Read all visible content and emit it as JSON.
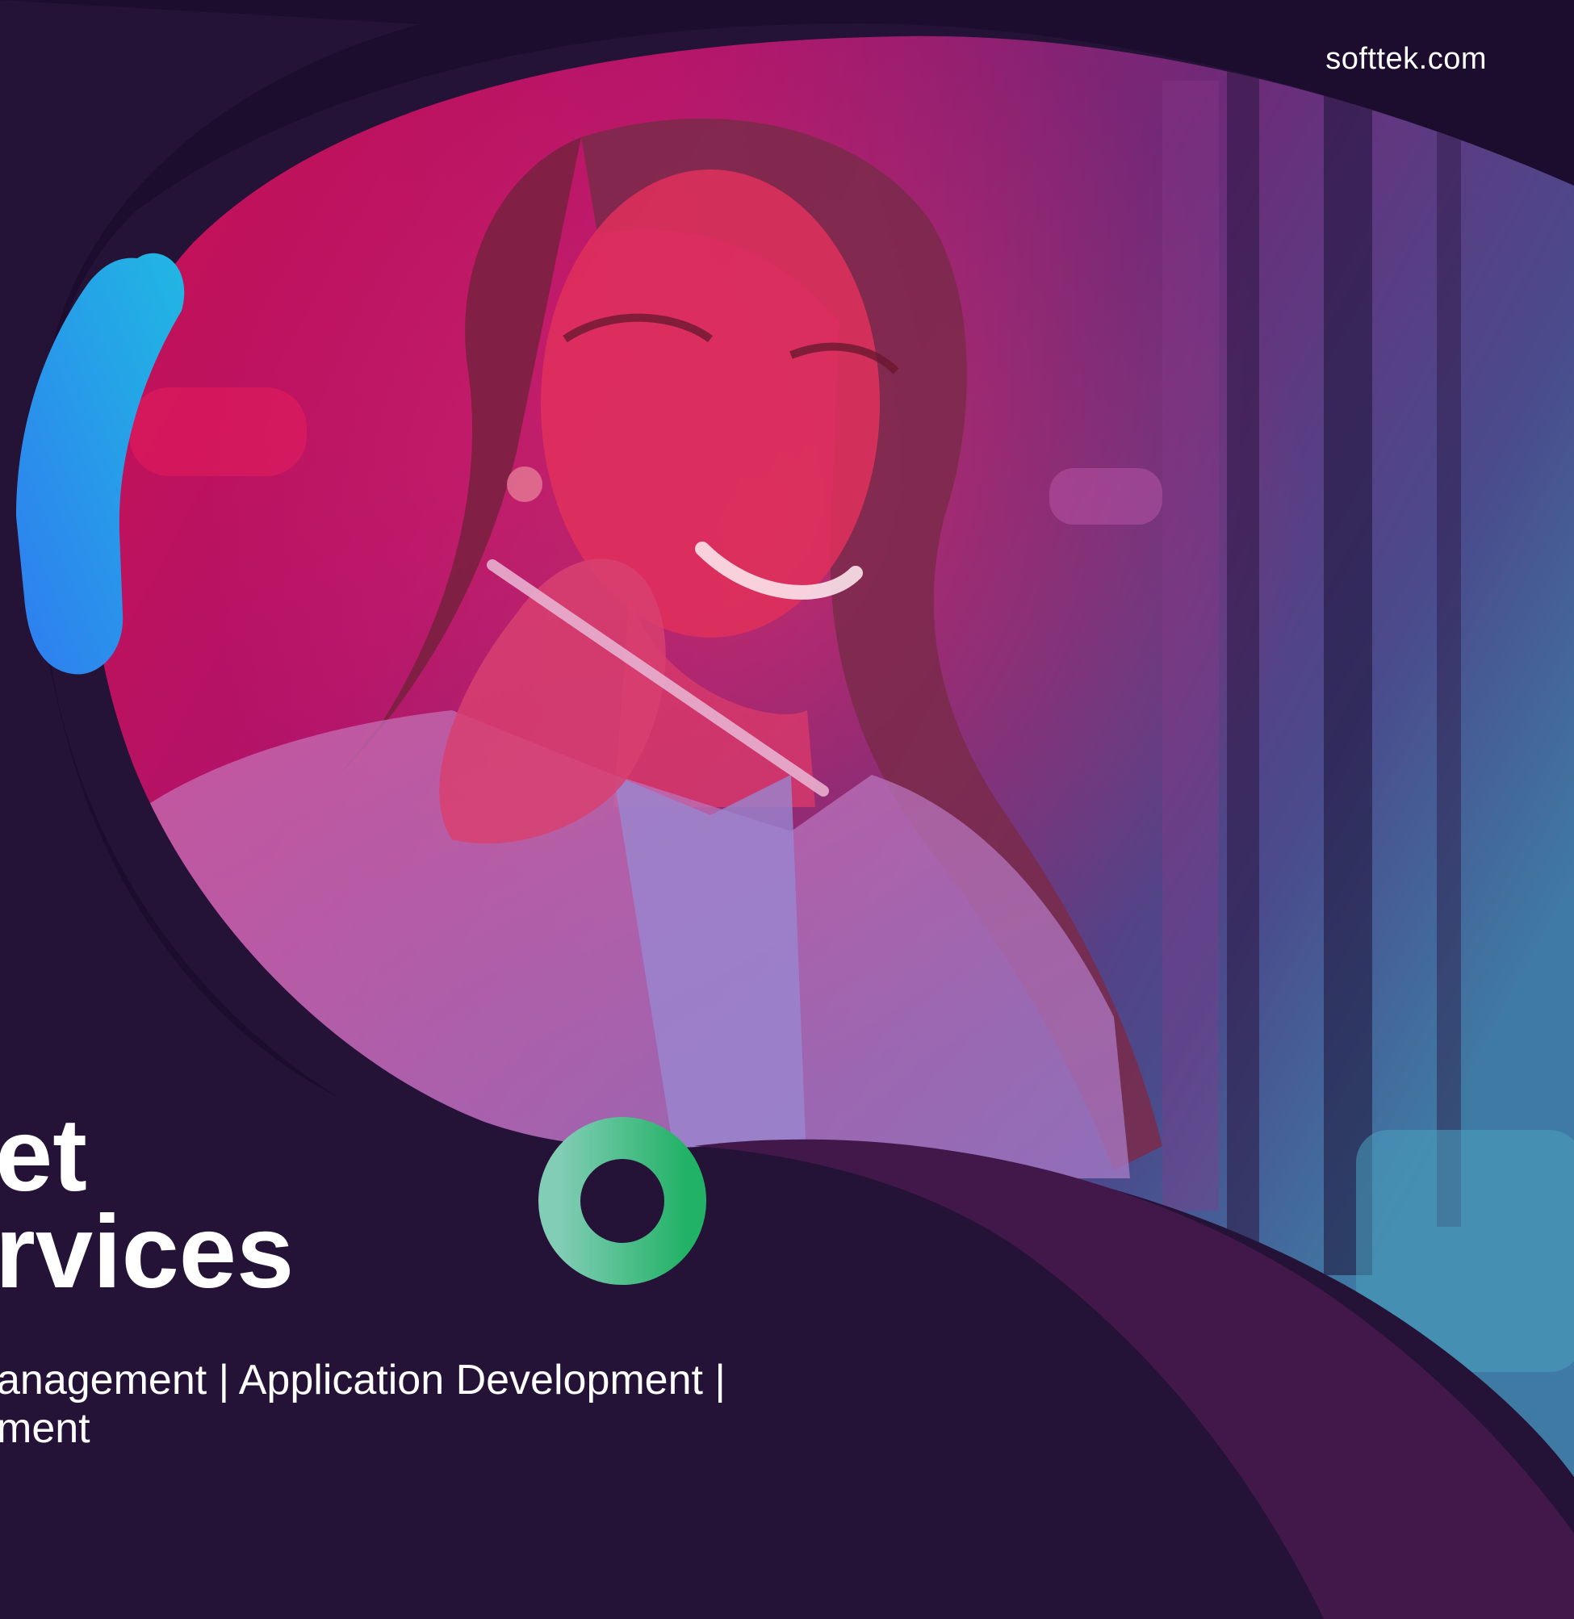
{
  "brand": {
    "site_url": "softtek.com"
  },
  "hero": {
    "headline_line1": "et",
    "headline_line2": "rvices",
    "subtitle_line1": "anagement | Application Development |",
    "subtitle_line2": "ment"
  },
  "colors": {
    "background": "#241237",
    "dark_curve": "#1c0d2f",
    "light_wave": "#42184a",
    "blue_accent_start": "#2f80f0",
    "blue_accent_end": "#22b6e4",
    "green_ring_start": "#7ccdb0",
    "green_ring_end": "#27b36d",
    "photo_magenta": "#c0115a"
  },
  "shapes": {
    "blue_accent": "blue-brush-stroke",
    "green_ring": "green-ring-icon"
  }
}
